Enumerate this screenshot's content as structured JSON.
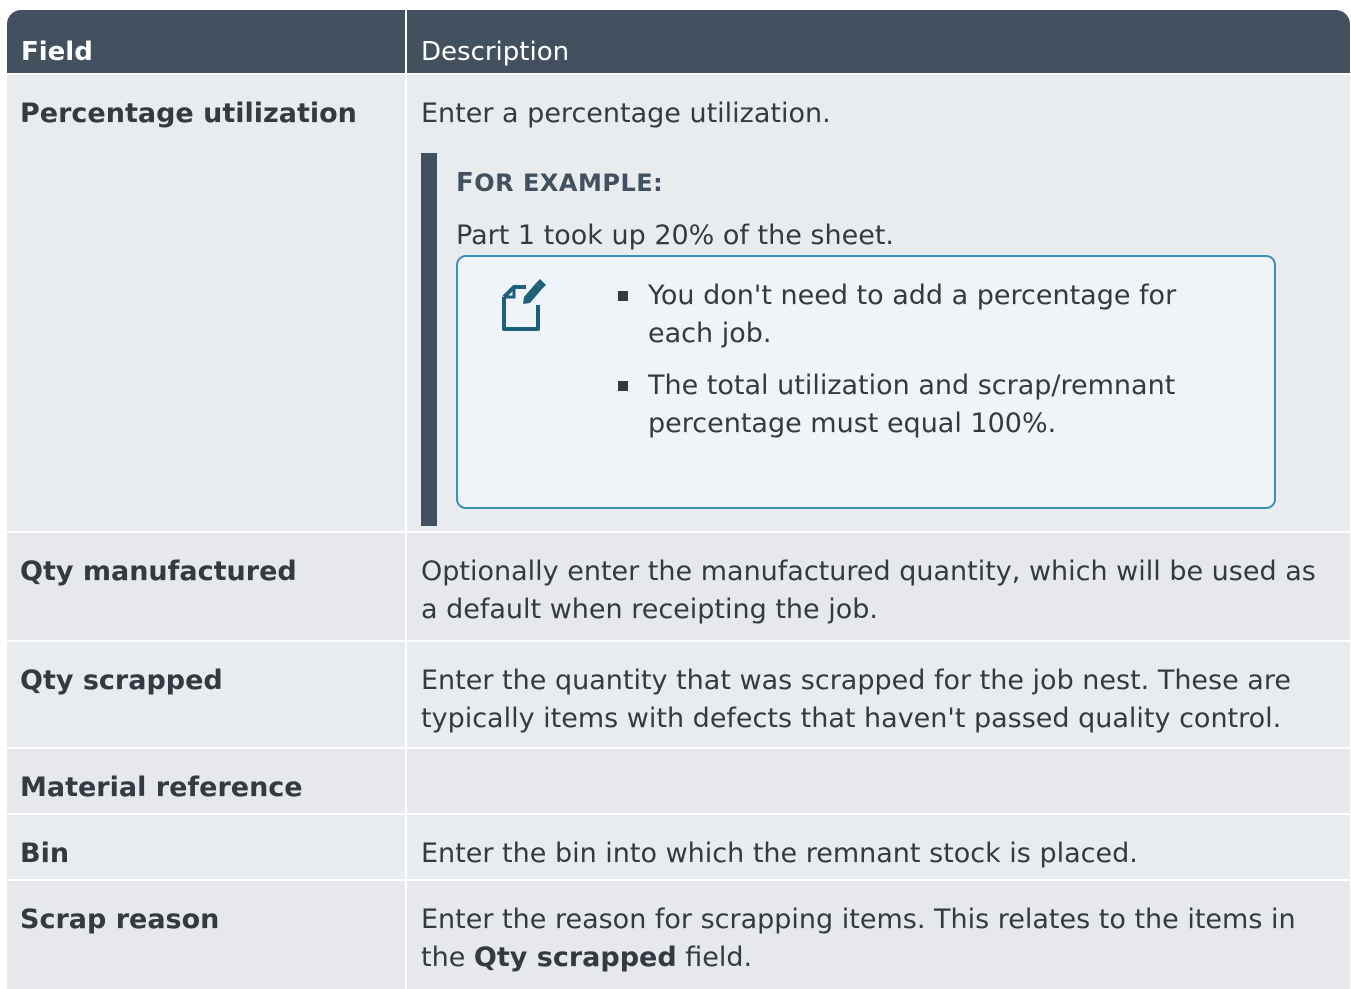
{
  "header": {
    "field": "Field",
    "description": "Description"
  },
  "rows": [
    {
      "field": "Percentage utilization",
      "description": "Enter a percentage utilization."
    },
    {
      "field": "Qty manufactured",
      "description": "Optionally enter the manufactured quantity, which will be used as a default when receipting the job."
    },
    {
      "field": "Qty scrapped",
      "description": "Enter the quantity that was scrapped for the job nest. These are typically items with defects that haven't passed quality control."
    },
    {
      "field": "Material reference",
      "description": ""
    },
    {
      "field": "Bin",
      "description": "Enter the bin into which the remnant stock is placed."
    },
    {
      "field": "Scrap reason",
      "description_prefix": "Enter the reason for scrapping items. This relates to the items in the ",
      "description_bold": "Qty scrapped",
      "description_suffix": " field."
    }
  ],
  "example": {
    "title_first": "F",
    "title_rest": "OR EXAMPLE:",
    "text": "Part 1 took up 20% of the sheet.",
    "note_icon": "edit-note-icon",
    "note_items": [
      "You don't need to add a percentage for each job.",
      "The total utilization and scrap/remnant percentage must equal 100%."
    ]
  },
  "colors": {
    "header_bg": "#42505f",
    "row_bg": "#e9ecef",
    "note_border": "#3d8fb0"
  }
}
